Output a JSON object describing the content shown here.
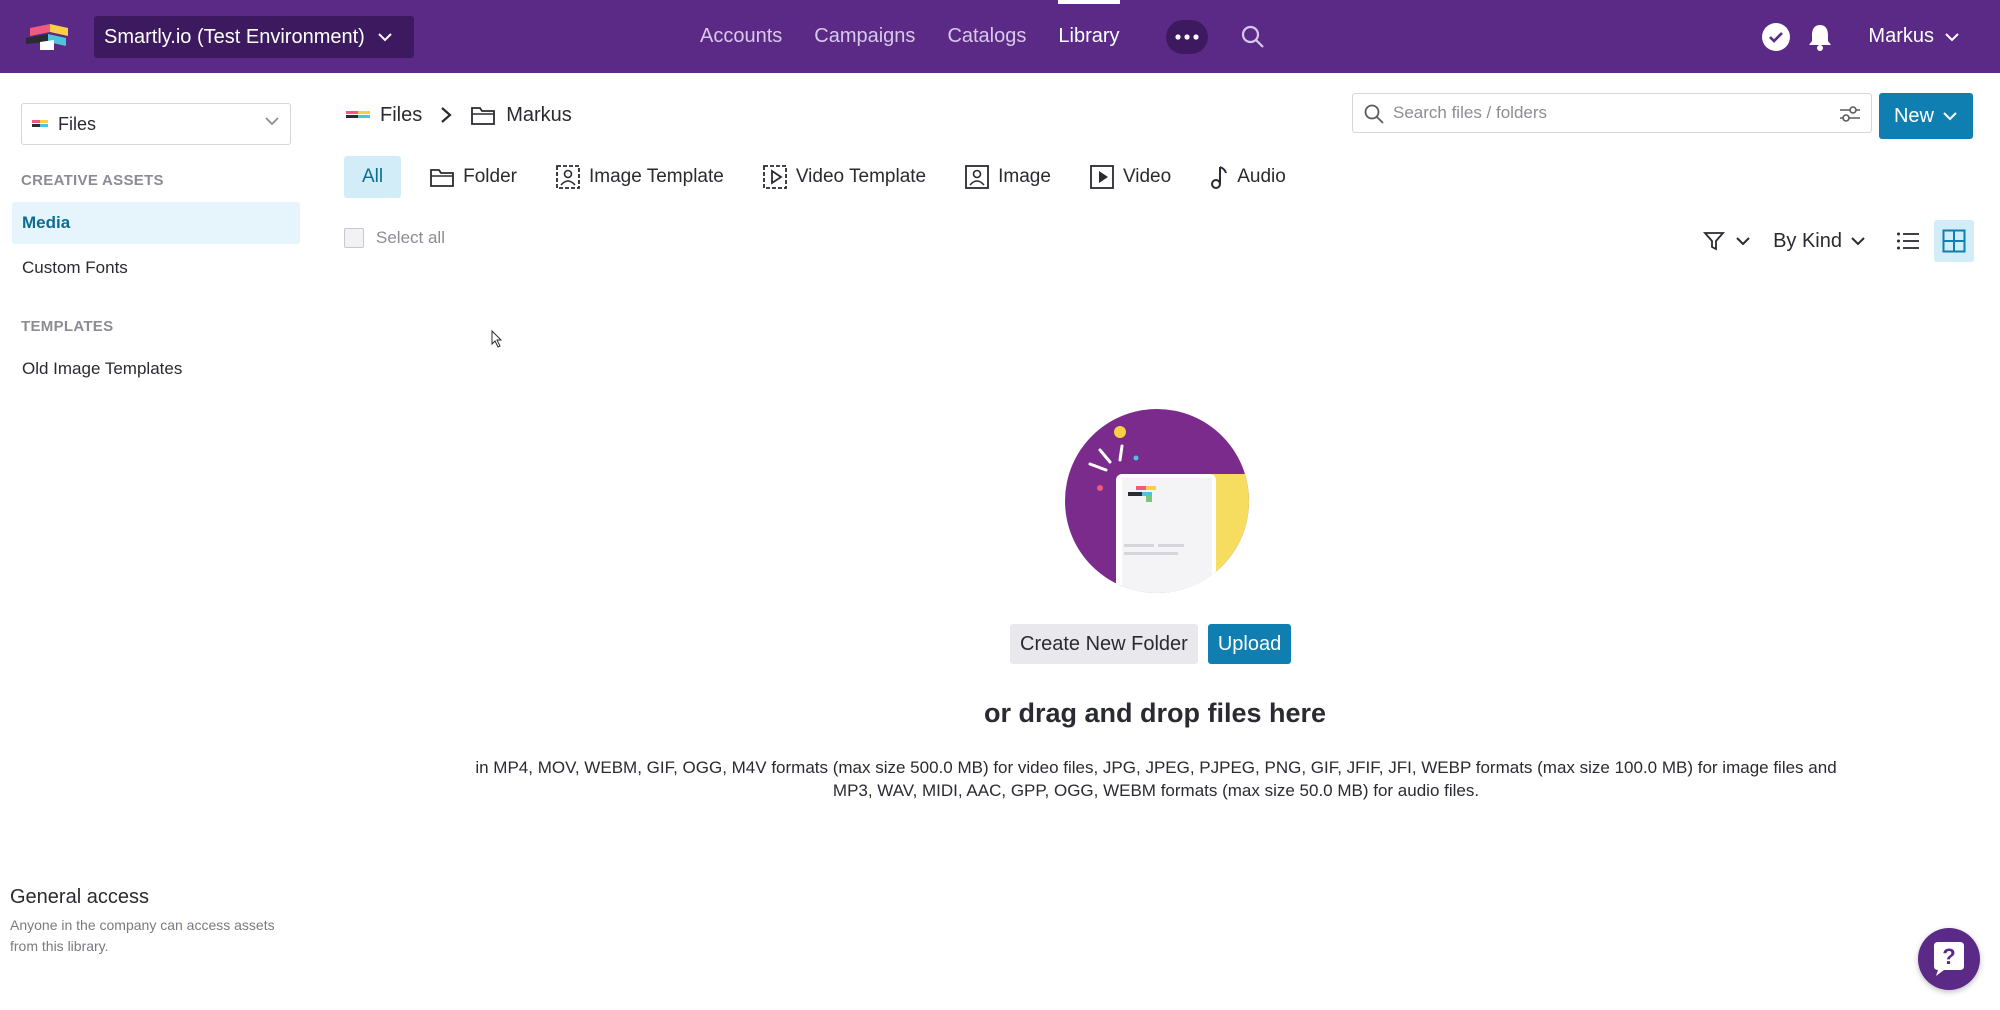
{
  "topbar": {
    "environment": "Smartly.io (Test Environment)",
    "nav": [
      "Accounts",
      "Campaigns",
      "Catalogs",
      "Library"
    ],
    "active_nav": "Library",
    "user": "Markus",
    "brand_color": "#5b2a86"
  },
  "sidebar": {
    "library_select": "Files",
    "creative_heading": "CREATIVE ASSETS",
    "creative_items": [
      "Media",
      "Custom Fonts"
    ],
    "templates_heading": "TEMPLATES",
    "template_items": [
      "Old Image Templates"
    ],
    "general_access_title": "General access",
    "general_access_desc": "Anyone in the company can access assets from this library."
  },
  "breadcrumb": {
    "root": "Files",
    "current": "Markus"
  },
  "search": {
    "placeholder": "Search files / folders"
  },
  "new_button": "New",
  "filters": [
    "All",
    "Folder",
    "Image Template",
    "Video Template",
    "Image",
    "Video",
    "Audio"
  ],
  "select_all": "Select all",
  "sort_label": "By Kind",
  "empty_state": {
    "create_folder": "Create New Folder",
    "upload": "Upload",
    "drag_text": "or drag and drop files here",
    "formats_line1": "in MP4, MOV, WEBM, GIF, OGG, M4V formats (max size 500.0 MB) for video files, JPG, JPEG, PJPEG, PNG, GIF, JFIF, JFI, WEBP formats (max size 100.0 MB) for image files and",
    "formats_line2": "MP3, WAV, MIDI, AAC, GPP, OGG, WEBM formats (max size 50.0 MB) for audio files."
  },
  "colors": {
    "accent": "#0e7fb0",
    "active_bg": "#d3edf8"
  }
}
